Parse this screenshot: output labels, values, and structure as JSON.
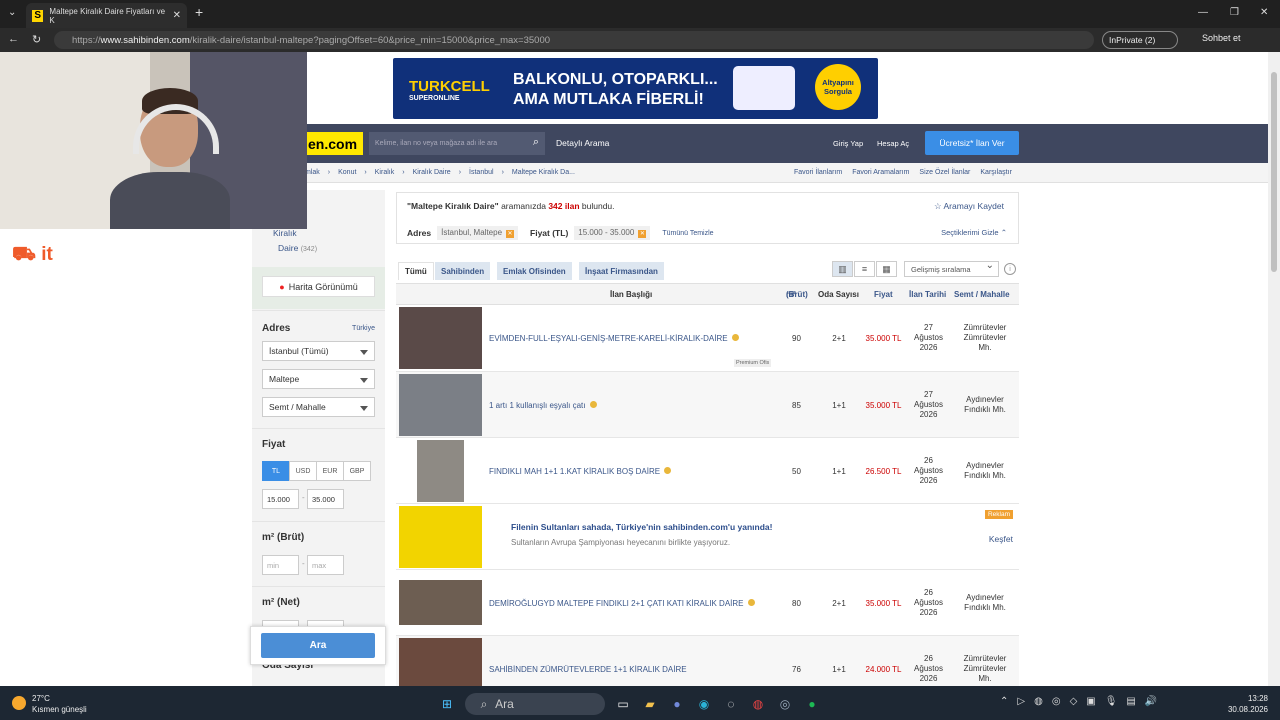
{
  "browser": {
    "tab_title": "Maltepe Kiralık Daire Fiyatları ve K",
    "tab_favicon": "S",
    "url_prefix": "https://",
    "url_host": "www.sahibinden.com",
    "url_path": "/kiralik-daire/istanbul-maltepe?pagingOffset=60&price_min=15000&price_max=35000",
    "inprivate_label": "InPrivate (2)",
    "chat_label": "Sohbet et"
  },
  "banner": {
    "brand": "TURKCELL",
    "brand_sub": "SUPERONLINE",
    "headline_1": "BALKONLU, OTOPARKLI...",
    "headline_2": "AMA MUTLAKA FİBERLİ!",
    "cta": "Altyapını Sorgula"
  },
  "nav": {
    "logo": "en.com",
    "search_placeholder": "Kelime, ilan no veya mağaza adı ile ara",
    "detailed_search": "Detaylı Arama",
    "login": "Giriş Yap",
    "register": "Hesap Aç",
    "post_ad": "Ücretsiz* İlan Ver"
  },
  "breadcrumbs": [
    "mlak",
    "Konut",
    "Kiralık",
    "Kiralık Daire",
    "İstanbul",
    "Maltepe Kiralık Da..."
  ],
  "top_links": [
    "Favori İlanlarım",
    "Favori Aramalarım",
    "Size Özel İlanlar",
    "Karşılaştır"
  ],
  "side_logo": "it",
  "sidebar": {
    "category_1": "Kiralık",
    "category_2": "Daire",
    "category_count": "(342)",
    "map_button": "Harita Görünümü",
    "address_title": "Adres",
    "address_link": "Türkiye",
    "city": "İstanbul (Tümü)",
    "district": "Maltepe",
    "neighborhood": "Semt / Mahalle",
    "price_title": "Fiyat",
    "currencies": [
      "TL",
      "USD",
      "EUR",
      "GBP"
    ],
    "price_min": "15.000",
    "price_max": "35.000",
    "m2_brut_title": "m² (Brüt)",
    "min_placeholder": "min",
    "max_placeholder": "max",
    "m2_net_title": "m² (Net)",
    "rooms_title": "Oda Sayısı",
    "search_button": "Ara"
  },
  "results": {
    "query_quoted": "\"Maltepe Kiralık Daire\"",
    "text_1": "aramanızda",
    "count": "342 ilan",
    "text_2": "bulundu.",
    "save_search": "Aramayı Kaydet",
    "address_label": "Adres",
    "address_chip": "İstanbul, Maltepe",
    "price_label": "Fiyat (TL)",
    "price_chip": "15.000 - 35.000",
    "clear_all": "Tümünü Temizle",
    "hide_selected": "Seçtiklerimi Gizle"
  },
  "tabs": [
    "Tümü",
    "Sahibinden",
    "Emlak Ofisinden",
    "İnşaat Firmasından"
  ],
  "sort_label": "Gelişmiş sıralama",
  "columns": {
    "title": "İlan Başlığı",
    "m2": "m²",
    "m2_sub": "(Brüt)",
    "rooms": "Oda Sayısı",
    "price": "Fiyat",
    "date": "İlan Tarihi",
    "location": "Semt / Mahalle"
  },
  "listings": [
    {
      "title": "EVİMDEN-FULL-EŞYALI-GENİŞ-METRE-KARELİ-KİRALIK-DAİRE",
      "m2": "90",
      "rooms": "2+1",
      "price": "35.000 TL",
      "date_1": "27",
      "date_2": "Ağustos",
      "date_3": "2026",
      "loc_1": "Zümrütevler",
      "loc_2": "Zümrütevler",
      "loc_3": "Mh.",
      "premium": "Premium Ofis"
    },
    {
      "title": "1 artı 1 kullanışlı eşyalı çatı",
      "m2": "85",
      "rooms": "1+1",
      "price": "35.000 TL",
      "date_1": "27",
      "date_2": "Ağustos",
      "date_3": "2026",
      "loc_1": "Aydınevler",
      "loc_2": "Fındıklı Mh.",
      "loc_3": ""
    },
    {
      "title": "FINDIKLI MAH 1+1 1.KAT KİRALIK BOŞ DAİRE",
      "m2": "50",
      "rooms": "1+1",
      "price": "26.500 TL",
      "date_1": "26",
      "date_2": "Ağustos",
      "date_3": "2026",
      "loc_1": "Aydınevler",
      "loc_2": "Fındıklı Mh.",
      "loc_3": ""
    },
    {
      "title": "DEMİROĞLUGYD MALTEPE FINDIKLI 2+1 ÇATI KATI KİRALIK DAİRE",
      "m2": "80",
      "rooms": "2+1",
      "price": "35.000 TL",
      "date_1": "26",
      "date_2": "Ağustos",
      "date_3": "2026",
      "loc_1": "Aydınevler",
      "loc_2": "Fındıklı Mh.",
      "loc_3": ""
    },
    {
      "title": "SAHİBİNDEN ZÜMRÜTEVLERDE 1+1 KİRALIK DAİRE",
      "m2": "76",
      "rooms": "1+1",
      "price": "24.000 TL",
      "date_1": "26",
      "date_2": "Ağustos",
      "date_3": "2026",
      "loc_1": "Zümrütevler",
      "loc_2": "Zümrütevler",
      "loc_3": "Mh."
    }
  ],
  "ad": {
    "title": "Filenin Sultanları sahada, Türkiye'nin sahibinden.com'u yanında!",
    "subtitle": "Sultanların Avrupa Şampiyonası heyecanını birlikte yaşıyoruz.",
    "badge": "Reklam",
    "link": "Keşfet"
  },
  "taskbar": {
    "temp": "27°C",
    "weather": "Kısmen güneşli",
    "search": "Ara",
    "time": "13:28",
    "date": "30.08.2026"
  }
}
